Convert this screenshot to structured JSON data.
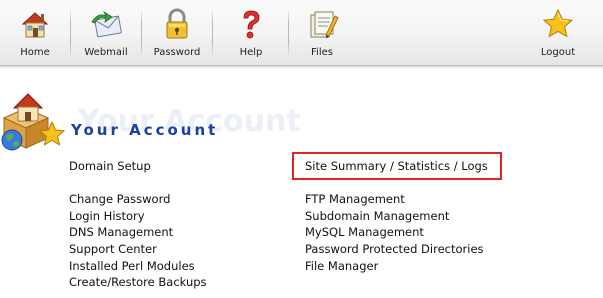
{
  "toolbar": {
    "items": [
      {
        "label": "Home",
        "icon": "home-icon"
      },
      {
        "label": "Webmail",
        "icon": "mail-icon"
      },
      {
        "label": "Password",
        "icon": "padlock-icon"
      },
      {
        "label": "Help",
        "icon": "question-icon"
      },
      {
        "label": "Files",
        "icon": "files-icon"
      },
      {
        "label": "Logout",
        "icon": "star-icon"
      }
    ]
  },
  "account": {
    "title": "Your Account",
    "watermark": "Your Account",
    "icon": "account-house-star-icon"
  },
  "links": {
    "left": [
      "Domain Setup",
      "Change Password",
      "Login History",
      "DNS Management",
      "Support Center",
      "Installed Perl Modules",
      "Create/Restore Backups"
    ],
    "right": [
      "Site Summary / Statistics / Logs",
      "FTP Management",
      "Subdomain Management",
      "MySQL Management",
      "Password Protected Directories",
      "File Manager"
    ]
  },
  "colors": {
    "title": "#1c3fa6",
    "highlight": "#e02424",
    "toolbar_bg": "#f3f3f3"
  }
}
